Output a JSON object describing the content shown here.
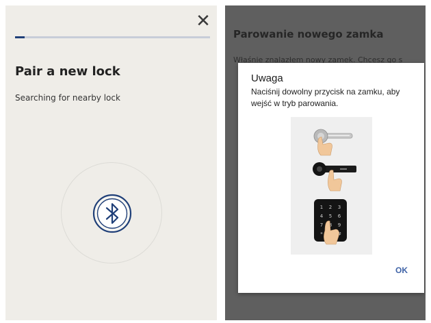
{
  "left_screen": {
    "close_label": "✕",
    "progress_percent": 5,
    "title": "Pair a new lock",
    "subtitle": "Searching for nearby lock",
    "colors": {
      "background": "#efede8",
      "accent": "#1f3f78",
      "track": "#c7cdd8"
    }
  },
  "right_screen": {
    "title": "Parowanie nowego zamka",
    "body_text": "Właśnie znalazłem nowy zamek. Chcesz go s",
    "dialog": {
      "title": "Uwaga",
      "body": "Naciśnij dowolny przycisk na zamku, aby wejść w tryb parowania.",
      "ok_label": "OK",
      "keypad_digits": [
        "1",
        "2",
        "3",
        "4",
        "5",
        "6",
        "7",
        "8",
        "9",
        "*",
        "0",
        "#"
      ]
    },
    "colors": {
      "overlay": "#5f5f5f",
      "ok": "#3f63a7"
    }
  }
}
